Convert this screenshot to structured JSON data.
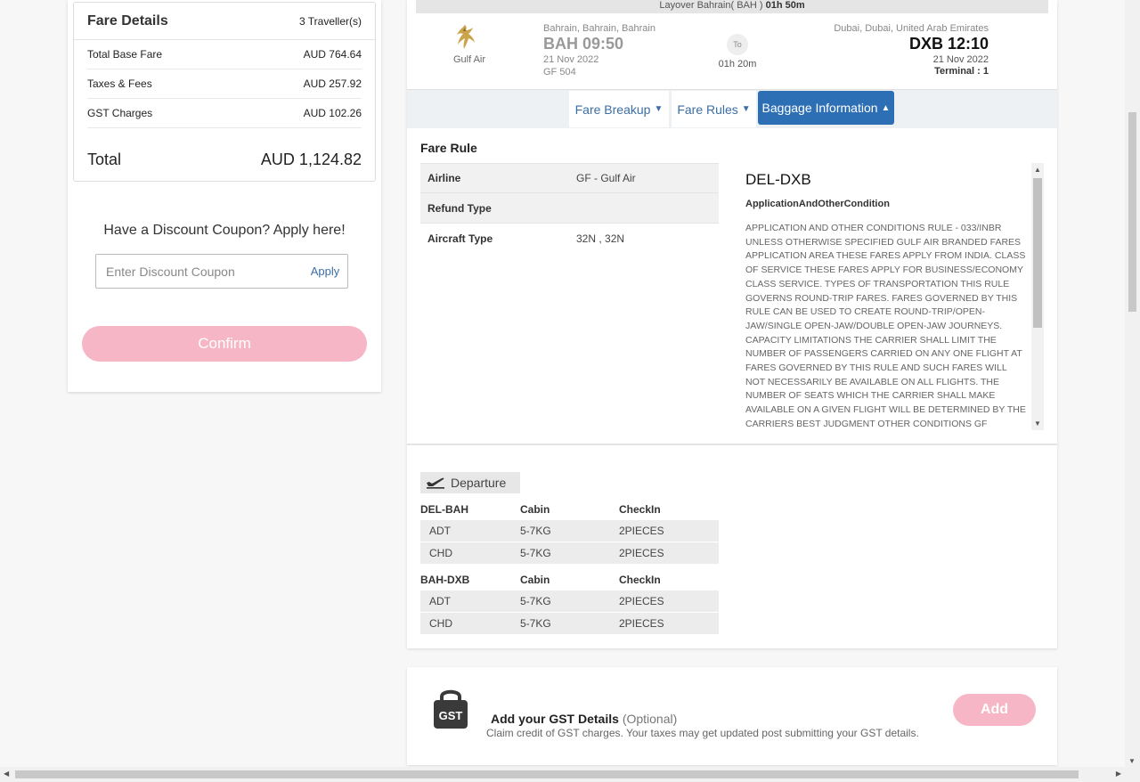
{
  "fare_details": {
    "title": "Fare Details",
    "travellers": "3 Traveller(s)",
    "rows": [
      {
        "label": "Total Base Fare",
        "value": "AUD 764.64"
      },
      {
        "label": "Taxes & Fees",
        "value": "AUD 257.92"
      },
      {
        "label": "GST Charges",
        "value": "AUD 102.26"
      }
    ],
    "total_label": "Total",
    "total_value": "AUD 1,124.82"
  },
  "coupon": {
    "question": "Have a Discount Coupon? Apply here!",
    "placeholder": "Enter Discount Coupon",
    "apply_label": "Apply"
  },
  "confirm_label": "Confirm",
  "flight": {
    "layover_prefix": "Layover Bahrain( BAH ) ",
    "layover_duration": "01h 50m",
    "airline": "Gulf Air",
    "departure": {
      "city": "Bahrain, Bahrain, Bahrain",
      "code_time": "BAH 09:50",
      "date": "21 Nov 2022",
      "flight_no": "GF 504"
    },
    "to_label": "To",
    "duration": "01h 20m",
    "arrival": {
      "city": "Dubai, Dubai, United Arab Emirates",
      "code_time": "DXB 12:10",
      "date": "21 Nov 2022",
      "terminal": "Terminal : 1"
    }
  },
  "tabs": [
    {
      "label": "Fare Breakup",
      "active": false
    },
    {
      "label": "Fare Rules",
      "active": false
    },
    {
      "label": "Baggage Information",
      "active": true
    }
  ],
  "fare_rule": {
    "title": "Fare Rule",
    "rows": [
      {
        "key": "Airline",
        "value": "GF - Gulf Air"
      },
      {
        "key": "Refund Type",
        "value": ""
      },
      {
        "key": "Aircraft Type",
        "value": "32N , 32N"
      }
    ],
    "segment": "DEL-DXB",
    "subtitle": "ApplicationAndOtherCondition",
    "body": "APPLICATION AND OTHER CONDITIONS RULE - 033/INBR UNLESS OTHERWISE SPECIFIED GULF AIR BRANDED FARES APPLICATION AREA THESE FARES APPLY FROM INDIA. CLASS OF SERVICE THESE FARES APPLY FOR BUSINESS/ECONOMY CLASS SERVICE. TYPES OF TRANSPORTATION THIS RULE GOVERNS ROUND-TRIP FARES. FARES GOVERNED BY THIS RULE CAN BE USED TO CREATE ROUND-TRIP/OPEN-JAW/SINGLE OPEN-JAW/DOUBLE OPEN-JAW JOURNEYS. CAPACITY LIMITATIONS THE CARRIER SHALL LIMIT THE NUMBER OF PASSENGERS CARRIED ON ANY ONE FLIGHT AT FARES GOVERNED BY THIS RULE AND SUCH FARES WILL NOT NECESSARILY BE AVAILABLE ON ALL FLIGHTS. THE NUMBER OF SEATS WHICH THE CARRIER SHALL MAKE AVAILABLE ON A GIVEN FLIGHT WILL BE DETERMINED BY THE CARRIERS BEST JUDGMENT OTHER CONDITIONS GF RESERVES THE RIGHT TO CANCEL ANY PNR"
  },
  "baggage": {
    "label": "Departure",
    "sectors": [
      {
        "route": "DEL-BAH",
        "cabin_h": "Cabin",
        "checkin_h": "CheckIn",
        "rows": [
          {
            "pax": "ADT",
            "cabin": "5-7KG",
            "checkin": "2PIECES"
          },
          {
            "pax": "CHD",
            "cabin": "5-7KG",
            "checkin": "2PIECES"
          }
        ]
      },
      {
        "route": "BAH-DXB",
        "cabin_h": "Cabin",
        "checkin_h": "CheckIn",
        "rows": [
          {
            "pax": "ADT",
            "cabin": "5-7KG",
            "checkin": "2PIECES"
          },
          {
            "pax": "CHD",
            "cabin": "5-7KG",
            "checkin": "2PIECES"
          }
        ]
      }
    ]
  },
  "gst": {
    "icon_text": "GST",
    "title": "Add your GST Details",
    "optional": "(Optional)",
    "desc": "Claim credit of GST charges. Your taxes may get updated post submitting your GST details.",
    "add_label": "Add"
  },
  "colors": {
    "accent": "#2c6fb5",
    "link": "#3a6ea5",
    "pink_button": "#f7b6c6"
  }
}
